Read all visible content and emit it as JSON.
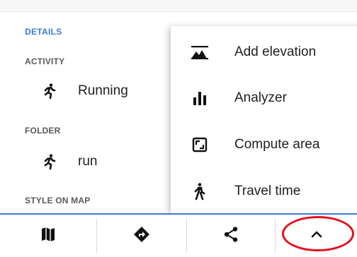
{
  "colors": {
    "accent": "#3a7bd5",
    "highlight": "#e3101b",
    "text": "#1f1f1f",
    "label": "#5a5a5a"
  },
  "details": {
    "header": "DETAILS",
    "activity_label": "ACTIVITY",
    "activity_value": "Running",
    "activity_icon": "running-icon",
    "folder_label": "FOLDER",
    "folder_value": "run",
    "folder_icon": "running-icon",
    "style_label": "STYLE ON MAP"
  },
  "menu": {
    "items": [
      {
        "label": "Add elevation",
        "icon": "elevation-icon"
      },
      {
        "label": "Analyzer",
        "icon": "bar-chart-icon"
      },
      {
        "label": "Compute area",
        "icon": "area-icon"
      },
      {
        "label": "Travel time",
        "icon": "hiking-icon"
      }
    ]
  },
  "bottom_bar": {
    "buttons": [
      {
        "icon": "map-icon"
      },
      {
        "icon": "navigate-icon"
      },
      {
        "icon": "share-icon"
      },
      {
        "icon": "chevron-up-icon"
      }
    ]
  }
}
